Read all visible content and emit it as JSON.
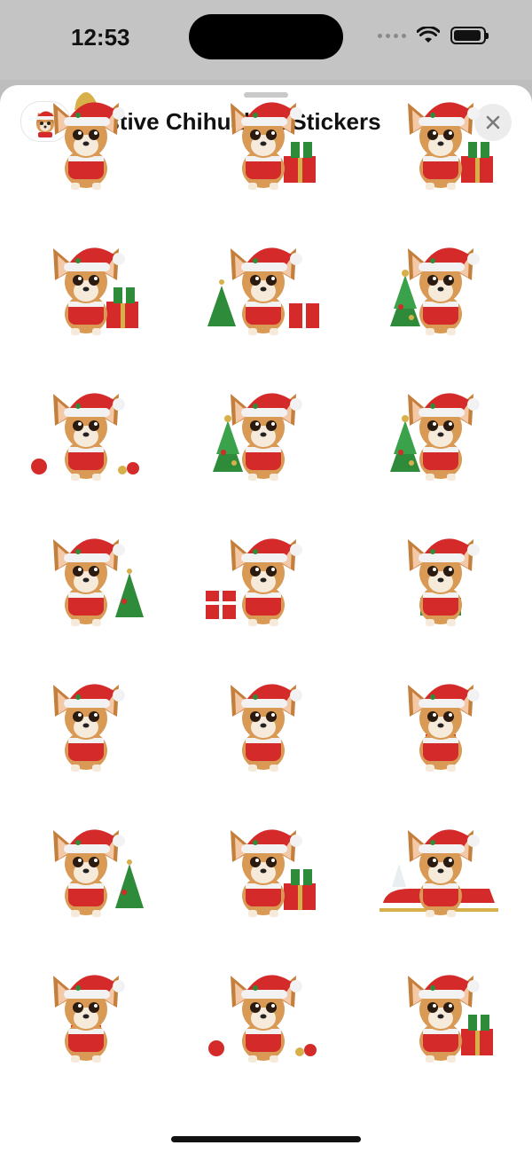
{
  "status_bar": {
    "time": "12:53",
    "icons": [
      "cellular-dots-icon",
      "wifi-icon",
      "battery-icon"
    ]
  },
  "sheet": {
    "title": "Festive Chihuahua Stickers",
    "app_icon": "chihuahua-santa-icon",
    "close_icon": "close-icon"
  },
  "stickers": [
    {
      "name": "sticker-1",
      "theme": "bell"
    },
    {
      "name": "sticker-2",
      "theme": "gifts"
    },
    {
      "name": "sticker-3",
      "theme": "gifts"
    },
    {
      "name": "sticker-4",
      "theme": "gifts"
    },
    {
      "name": "sticker-5",
      "theme": "tree-gifts"
    },
    {
      "name": "sticker-6",
      "theme": "tree"
    },
    {
      "name": "sticker-7",
      "theme": "ornaments"
    },
    {
      "name": "sticker-8",
      "theme": "tree"
    },
    {
      "name": "sticker-9",
      "theme": "tree"
    },
    {
      "name": "sticker-10",
      "theme": "tree-sweater"
    },
    {
      "name": "sticker-11",
      "theme": "gift"
    },
    {
      "name": "sticker-12",
      "theme": "sweater"
    },
    {
      "name": "sticker-13",
      "theme": "plain"
    },
    {
      "name": "sticker-14",
      "theme": "plain"
    },
    {
      "name": "sticker-15",
      "theme": "scarf"
    },
    {
      "name": "sticker-16",
      "theme": "tree-sweater"
    },
    {
      "name": "sticker-17",
      "theme": "gifts"
    },
    {
      "name": "sticker-18",
      "theme": "sleigh"
    },
    {
      "name": "sticker-19",
      "theme": "scarf"
    },
    {
      "name": "sticker-20",
      "theme": "ornaments"
    },
    {
      "name": "sticker-21",
      "theme": "gifts"
    }
  ],
  "colors": {
    "santa_red": "#d42a2a",
    "fur_tan": "#d99a55",
    "hat_white": "#f2f2f2",
    "holly_green": "#2e8b3a",
    "gold": "#d8b04a"
  }
}
